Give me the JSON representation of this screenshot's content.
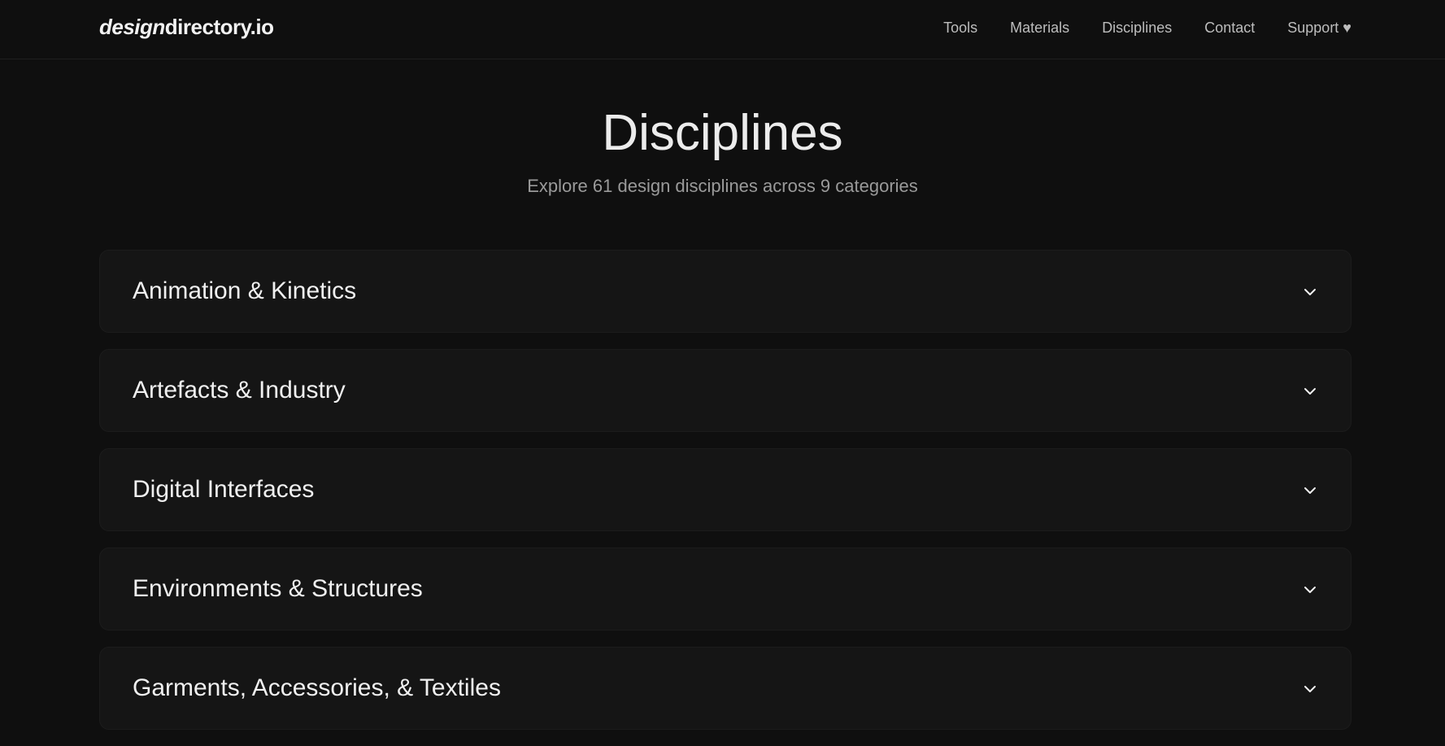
{
  "header": {
    "logo_italic": "design",
    "logo_rest": "directory.io",
    "nav": [
      {
        "label": "Tools"
      },
      {
        "label": "Materials"
      },
      {
        "label": "Disciplines"
      },
      {
        "label": "Contact"
      },
      {
        "label": "Support ♥"
      }
    ]
  },
  "hero": {
    "title": "Disciplines",
    "subtitle": "Explore 61 design disciplines across 9 categories"
  },
  "categories": [
    {
      "label": "Animation & Kinetics"
    },
    {
      "label": "Artefacts & Industry"
    },
    {
      "label": "Digital Interfaces"
    },
    {
      "label": "Environments & Structures"
    },
    {
      "label": "Garments, Accessories, & Textiles"
    }
  ],
  "icons": {
    "chevron": "chevron-down-icon"
  }
}
